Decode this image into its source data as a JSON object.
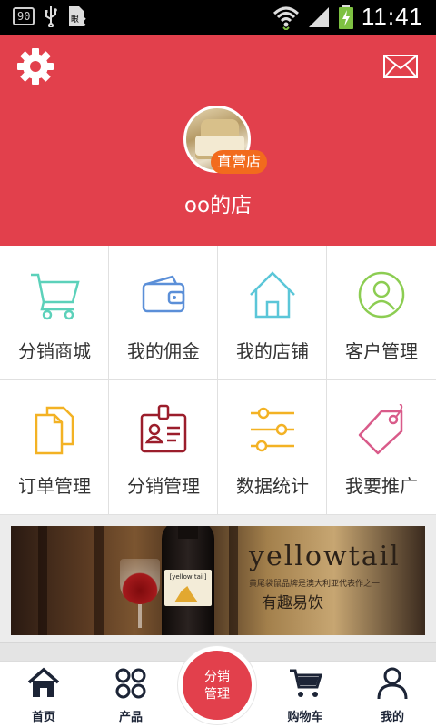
{
  "status_bar": {
    "badge": "90",
    "time": "11:41"
  },
  "header": {
    "settings_icon": "gear-icon",
    "mail_icon": "envelope-icon",
    "store_tag": "直营店",
    "store_name": "oo的店",
    "bg_color": "#e2404c"
  },
  "grid": {
    "items": [
      {
        "label": "分销商城",
        "icon": "cart-icon",
        "color": "#5cd1ba"
      },
      {
        "label": "我的佣金",
        "icon": "wallet-icon",
        "color": "#5b8fd8"
      },
      {
        "label": "我的店铺",
        "icon": "house-icon",
        "color": "#5bc6d8"
      },
      {
        "label": "客户管理",
        "icon": "user-circle-icon",
        "color": "#8ccd52"
      },
      {
        "label": "订单管理",
        "icon": "documents-icon",
        "color": "#f3b224"
      },
      {
        "label": "分销管理",
        "icon": "id-badge-icon",
        "color": "#9b1d2b"
      },
      {
        "label": "数据统计",
        "icon": "sliders-icon",
        "color": "#f3b224"
      },
      {
        "label": "我要推广",
        "icon": "tag-icon",
        "color": "#d95b8a"
      }
    ]
  },
  "banner": {
    "brand": "yellowtail",
    "sub": "黄尾袋鼠品牌是澳大利亚代表作之一",
    "slogan": "有趣易饮",
    "bottle_label": "[yellow tail]"
  },
  "bottom_nav": {
    "items": [
      {
        "label": "首页",
        "icon": "home-icon"
      },
      {
        "label": "产品",
        "icon": "grid-four-icon"
      },
      {
        "label": "购物车",
        "icon": "cart-icon"
      },
      {
        "label": "我的",
        "icon": "person-icon"
      }
    ],
    "center": {
      "line1": "分销",
      "line2": "管理"
    }
  }
}
